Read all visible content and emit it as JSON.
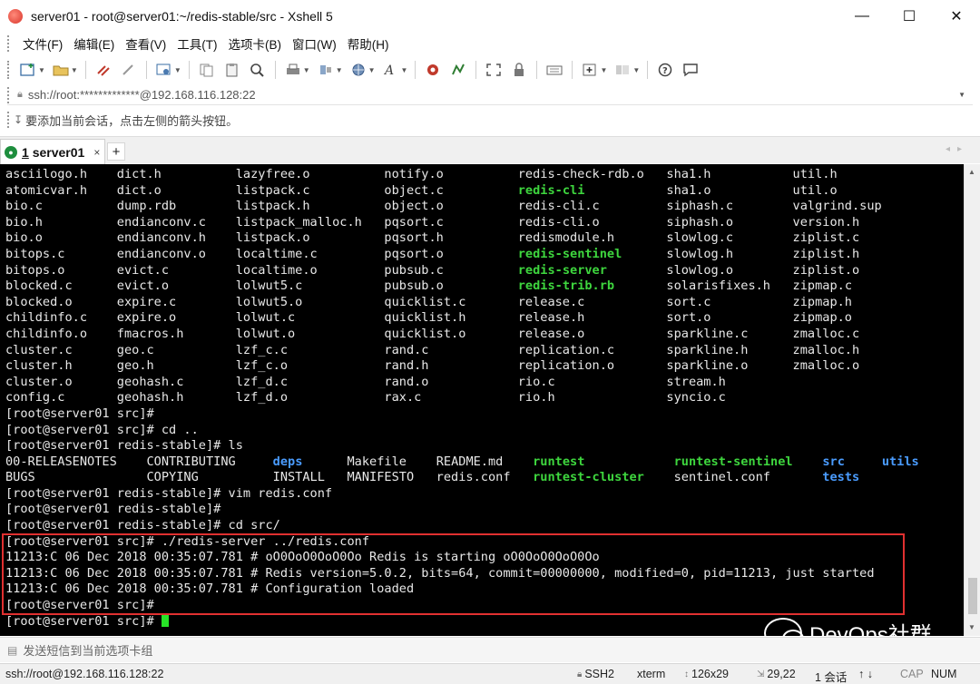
{
  "window": {
    "title": "server01 - root@server01:~/redis-stable/src - Xshell 5",
    "minimize": "—",
    "maximize": "☐",
    "close": "✕"
  },
  "menu": {
    "items": [
      "文件(F)",
      "编辑(E)",
      "查看(V)",
      "工具(T)",
      "选项卡(B)",
      "窗口(W)",
      "帮助(H)"
    ]
  },
  "address": {
    "value": "ssh://root:*************@192.168.116.128:22"
  },
  "hint": {
    "text": "要添加当前会话，点击左侧的箭头按钮。"
  },
  "tab": {
    "number": "1",
    "label": "server01",
    "close": "×",
    "add": "+"
  },
  "terminal": {
    "listing": [
      [
        "asciilogo.h",
        "dict.h",
        "lazyfree.o",
        "notify.o",
        "redis-check-rdb.o",
        "sha1.h",
        "util.h"
      ],
      [
        "atomicvar.h",
        "dict.o",
        "listpack.c",
        "object.c",
        "redis-cli",
        "sha1.o",
        "util.o"
      ],
      [
        "bio.c",
        "dump.rdb",
        "listpack.h",
        "object.o",
        "redis-cli.c",
        "siphash.c",
        "valgrind.sup"
      ],
      [
        "bio.h",
        "endianconv.c",
        "listpack_malloc.h",
        "pqsort.c",
        "redis-cli.o",
        "siphash.o",
        "version.h"
      ],
      [
        "bio.o",
        "endianconv.h",
        "listpack.o",
        "pqsort.h",
        "redismodule.h",
        "slowlog.c",
        "ziplist.c"
      ],
      [
        "bitops.c",
        "endianconv.o",
        "localtime.c",
        "pqsort.o",
        "redis-sentinel",
        "slowlog.h",
        "ziplist.h"
      ],
      [
        "bitops.o",
        "evict.c",
        "localtime.o",
        "pubsub.c",
        "redis-server",
        "slowlog.o",
        "ziplist.o"
      ],
      [
        "blocked.c",
        "evict.o",
        "lolwut5.c",
        "pubsub.o",
        "redis-trib.rb",
        "solarisfixes.h",
        "zipmap.c"
      ],
      [
        "blocked.o",
        "expire.c",
        "lolwut5.o",
        "quicklist.c",
        "release.c",
        "sort.c",
        "zipmap.h"
      ],
      [
        "childinfo.c",
        "expire.o",
        "lolwut.c",
        "quicklist.h",
        "release.h",
        "sort.o",
        "zipmap.o"
      ],
      [
        "childinfo.o",
        "fmacros.h",
        "lolwut.o",
        "quicklist.o",
        "release.o",
        "sparkline.c",
        "zmalloc.c"
      ],
      [
        "cluster.c",
        "geo.c",
        "lzf_c.c",
        "rand.c",
        "replication.c",
        "sparkline.h",
        "zmalloc.h"
      ],
      [
        "cluster.h",
        "geo.h",
        "lzf_c.o",
        "rand.h",
        "replication.o",
        "sparkline.o",
        "zmalloc.o"
      ],
      [
        "cluster.o",
        "geohash.c",
        "lzf_d.c",
        "rand.o",
        "rio.c",
        "stream.h",
        ""
      ],
      [
        "config.c",
        "geohash.h",
        "lzf_d.o",
        "rax.c",
        "rio.h",
        "syncio.c",
        ""
      ]
    ],
    "executables": [
      "redis-cli",
      "redis-sentinel",
      "redis-server",
      "redis-trib.rb"
    ],
    "prompt_src": "[root@server01 src]# ",
    "prompt_stable": "[root@server01 redis-stable]# ",
    "cmd_cd_up": "cd ..",
    "cmd_ls": "ls",
    "ls_row1": [
      "00-RELEASENOTES",
      "CONTRIBUTING",
      "deps",
      "Makefile",
      "README.md",
      "runtest",
      "runtest-sentinel",
      "src",
      "utils"
    ],
    "ls_row2": [
      "BUGS",
      "COPYING",
      "INSTALL",
      "MANIFESTO",
      "redis.conf",
      "runtest-cluster",
      "sentinel.conf",
      "tests"
    ],
    "cmd_vim": "vim redis.conf",
    "cmd_cd_src": "cd src/",
    "cmd_server": "./redis-server ../redis.conf",
    "log": [
      "11213:C 06 Dec 2018 00:35:07.781 # oO0OoO0OoO0Oo Redis is starting oO0OoO0OoO0Oo",
      "11213:C 06 Dec 2018 00:35:07.781 # Redis version=5.0.2, bits=64, commit=00000000, modified=0, pid=11213, just started",
      "11213:C 06 Dec 2018 00:35:07.781 # Configuration loaded"
    ]
  },
  "compose": {
    "placeholder": "发送短信到当前选项卡组"
  },
  "watermark": {
    "text": "DevOps社群"
  },
  "status": {
    "connection": "ssh://root@192.168.116.128:22",
    "protocol": "SSH2",
    "terminal": "xterm",
    "size": "126x29",
    "cursor": "29,22",
    "sessions": "1 会话",
    "caps": "CAP",
    "num": "NUM"
  },
  "colors": {
    "terminal_bg": "#000000",
    "terminal_fg": "#e8e8e8",
    "exec_green": "#3ed63e",
    "dir_blue": "#4a9cff",
    "cursor_green": "#27e427",
    "highlight_red": "#e03030"
  }
}
